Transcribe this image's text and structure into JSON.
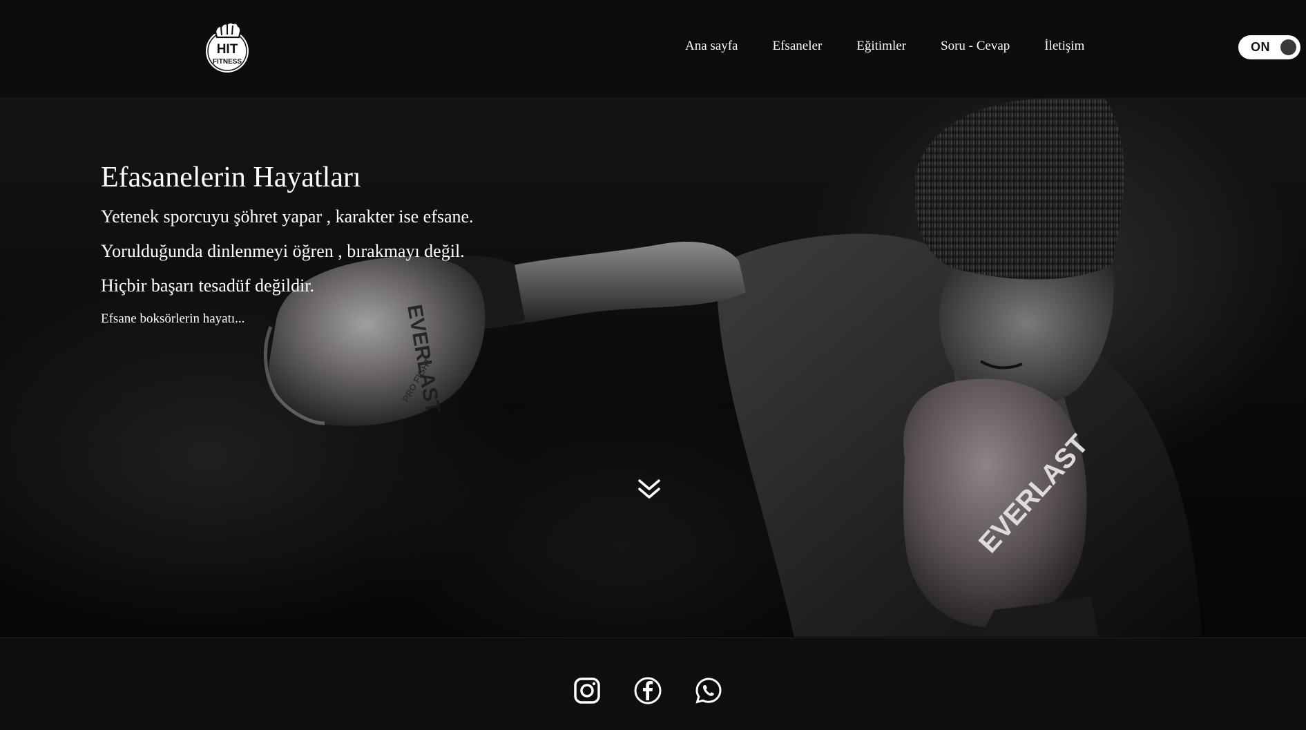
{
  "header": {
    "logo": {
      "text_top": "HIT",
      "text_bottom": "FITNESS"
    },
    "nav": [
      {
        "label": "Ana sayfa"
      },
      {
        "label": "Efsaneler"
      },
      {
        "label": "Eğitimler"
      },
      {
        "label": "Soru - Cevap"
      },
      {
        "label": "İletişim"
      }
    ],
    "toggle": {
      "label": "ON",
      "state": "on"
    }
  },
  "hero": {
    "title": "Efasanelerin Hayatları",
    "quotes": [
      "Yetenek sporcuyu şöhret yapar , karakter ise efsane.",
      "Yorulduğunda dinlenmeyi öğren , bırakmayı değil.",
      "Hiçbir başarı tesadüf değildir."
    ],
    "link": "Efsane boksörlerin hayatı...",
    "scroll_icon": "double-chevron-down-icon",
    "background_image": "boxer-punching-photo",
    "glove_brand_left": "PRO FIGHT",
    "glove_brand_right": "EVERLAST"
  },
  "footer": {
    "social": [
      {
        "name": "instagram-icon"
      },
      {
        "name": "facebook-icon"
      },
      {
        "name": "whatsapp-icon"
      }
    ]
  },
  "colors": {
    "background": "#0e0e0f",
    "text": "#ffffff",
    "toggle_bg": "#ffffff",
    "toggle_knob": "#3a3a3a"
  }
}
